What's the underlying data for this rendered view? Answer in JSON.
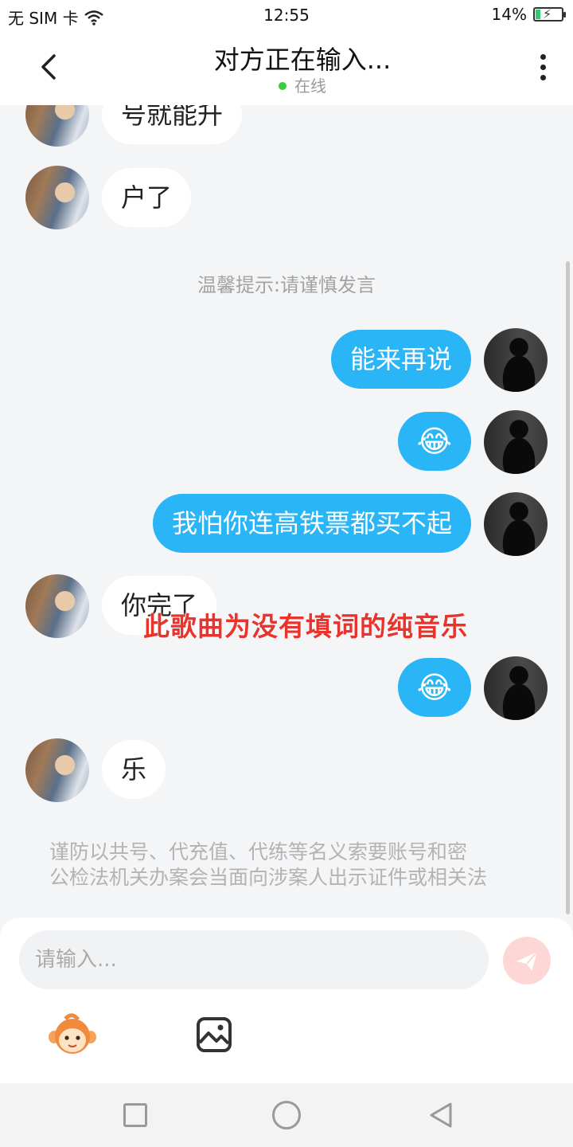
{
  "status_bar": {
    "carrier": "无 SIM 卡",
    "time": "12:55",
    "battery": "14%"
  },
  "header": {
    "title": "对方正在输入...",
    "status": "在线"
  },
  "chat": {
    "tip": "温馨提示:请谨慎发言",
    "messages": [
      {
        "side": "in",
        "text": "号就能升"
      },
      {
        "side": "in",
        "text": "户了"
      },
      {
        "side": "out",
        "text": "能来再说"
      },
      {
        "side": "out",
        "text": "😂"
      },
      {
        "side": "out",
        "text": "我怕你连高铁票都买不起"
      },
      {
        "side": "in",
        "text": "你完了"
      },
      {
        "side": "out",
        "text": "😂"
      },
      {
        "side": "in",
        "text": "乐"
      }
    ],
    "warning_line1": "谨防以共号、代充值、代练等名义索要账号和密",
    "warning_line2": "公检法机关办案会当面向涉案人出示证件或相关法",
    "overlay": "此歌曲为没有填词的纯音乐"
  },
  "input": {
    "placeholder": "请输入..."
  },
  "colors": {
    "accent": "#29b5f6",
    "overlay": "#e8342c",
    "send_disabled": "#fdd7d5"
  },
  "icons": {
    "back": "chevron-left-icon",
    "more": "more-vertical-icon",
    "send": "paper-plane-icon",
    "mascot": "monkey-mascot-icon",
    "image": "image-icon"
  }
}
